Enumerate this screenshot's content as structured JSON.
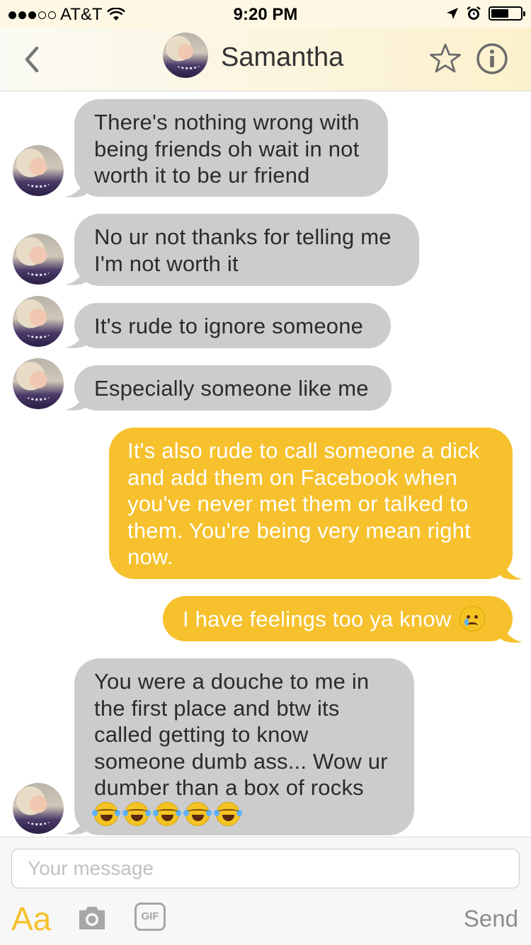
{
  "status_bar": {
    "carrier": "AT&T",
    "time": "9:20 PM"
  },
  "header": {
    "contact_name": "Samantha"
  },
  "messages": [
    {
      "side": "incoming",
      "text": "There's nothing wrong with being friends oh wait in not worth it to be ur friend"
    },
    {
      "side": "incoming",
      "text": "No ur not thanks for telling me I'm not worth it"
    },
    {
      "side": "incoming",
      "text": "It's rude to ignore someone"
    },
    {
      "side": "incoming",
      "text": "Especially someone like me"
    },
    {
      "side": "outgoing",
      "text": "It's also rude to call someone a dick and add them on Facebook when you've never met them or talked to them. You're being very mean right now."
    },
    {
      "side": "outgoing",
      "text": "I have feelings too ya know",
      "emoji": "crying-face"
    },
    {
      "side": "incoming",
      "text": "You were a douche to me in the first place and btw its called getting to know someone dumb ass... Wow ur dumber than a box of rocks",
      "emoji": "tears-of-joy x5"
    }
  ],
  "composer": {
    "placeholder": "Your message",
    "font_button": "Aa",
    "gif_button": "GIF",
    "send_label": "Send"
  },
  "colors": {
    "incoming_bubble": "#cccccc",
    "outgoing_bubble": "#f6c12d",
    "accent": "#f6c12d"
  }
}
